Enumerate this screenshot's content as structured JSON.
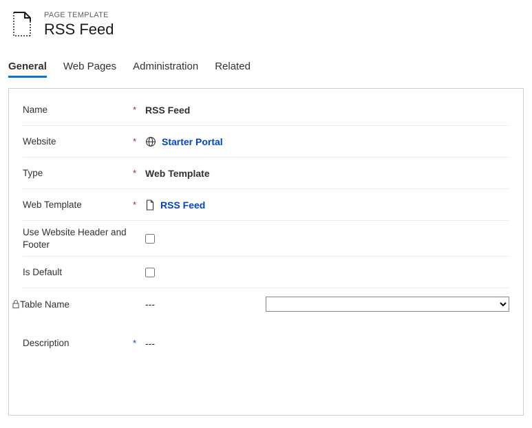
{
  "header": {
    "subtitle": "PAGE TEMPLATE",
    "title": "RSS Feed"
  },
  "tabs": [
    {
      "label": "General",
      "active": true
    },
    {
      "label": "Web Pages",
      "active": false
    },
    {
      "label": "Administration",
      "active": false
    },
    {
      "label": "Related",
      "active": false
    }
  ],
  "form": {
    "name": {
      "label": "Name",
      "required": true,
      "value": "RSS Feed"
    },
    "website": {
      "label": "Website",
      "required": true,
      "value": "Starter Portal"
    },
    "type": {
      "label": "Type",
      "required": true,
      "value": "Web Template"
    },
    "web_template": {
      "label": "Web Template",
      "required": true,
      "value": "RSS Feed"
    },
    "use_header_footer": {
      "label": "Use Website Header and Footer",
      "checked": false
    },
    "is_default": {
      "label": "Is Default",
      "checked": false
    },
    "table_name": {
      "label": "Table Name",
      "value": "---",
      "select_value": ""
    },
    "description": {
      "label": "Description",
      "recommended": true,
      "value": "---"
    }
  }
}
